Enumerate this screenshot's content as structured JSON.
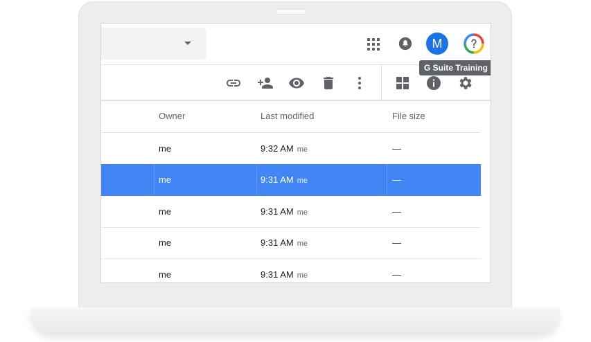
{
  "topbar": {
    "avatar_letter": "M",
    "tooltip": "G Suite Training",
    "icons": [
      "apps-icon",
      "notifications-icon",
      "help-icon"
    ]
  },
  "toolbar": {
    "icons": [
      "link-icon",
      "share-icon",
      "preview-icon",
      "delete-icon",
      "more-icon",
      "grid-view-icon",
      "info-icon",
      "settings-icon"
    ]
  },
  "table": {
    "headers": {
      "owner": "Owner",
      "last_modified": "Last modified",
      "file_size": "File size"
    },
    "rows": [
      {
        "owner": "me",
        "time": "9:32 AM",
        "by": "me",
        "size": "—",
        "selected": false
      },
      {
        "owner": "me",
        "time": "9:31 AM",
        "by": "me",
        "size": "—",
        "selected": true
      },
      {
        "owner": "me",
        "time": "9:31 AM",
        "by": "me",
        "size": "—",
        "selected": false
      },
      {
        "owner": "me",
        "time": "9:31 AM",
        "by": "me",
        "size": "—",
        "selected": false
      },
      {
        "owner": "me",
        "time": "9:31 AM",
        "by": "me",
        "size": "—",
        "selected": false
      }
    ]
  },
  "colors": {
    "selected_row": "#4285f4",
    "avatar": "#1a73e8"
  }
}
